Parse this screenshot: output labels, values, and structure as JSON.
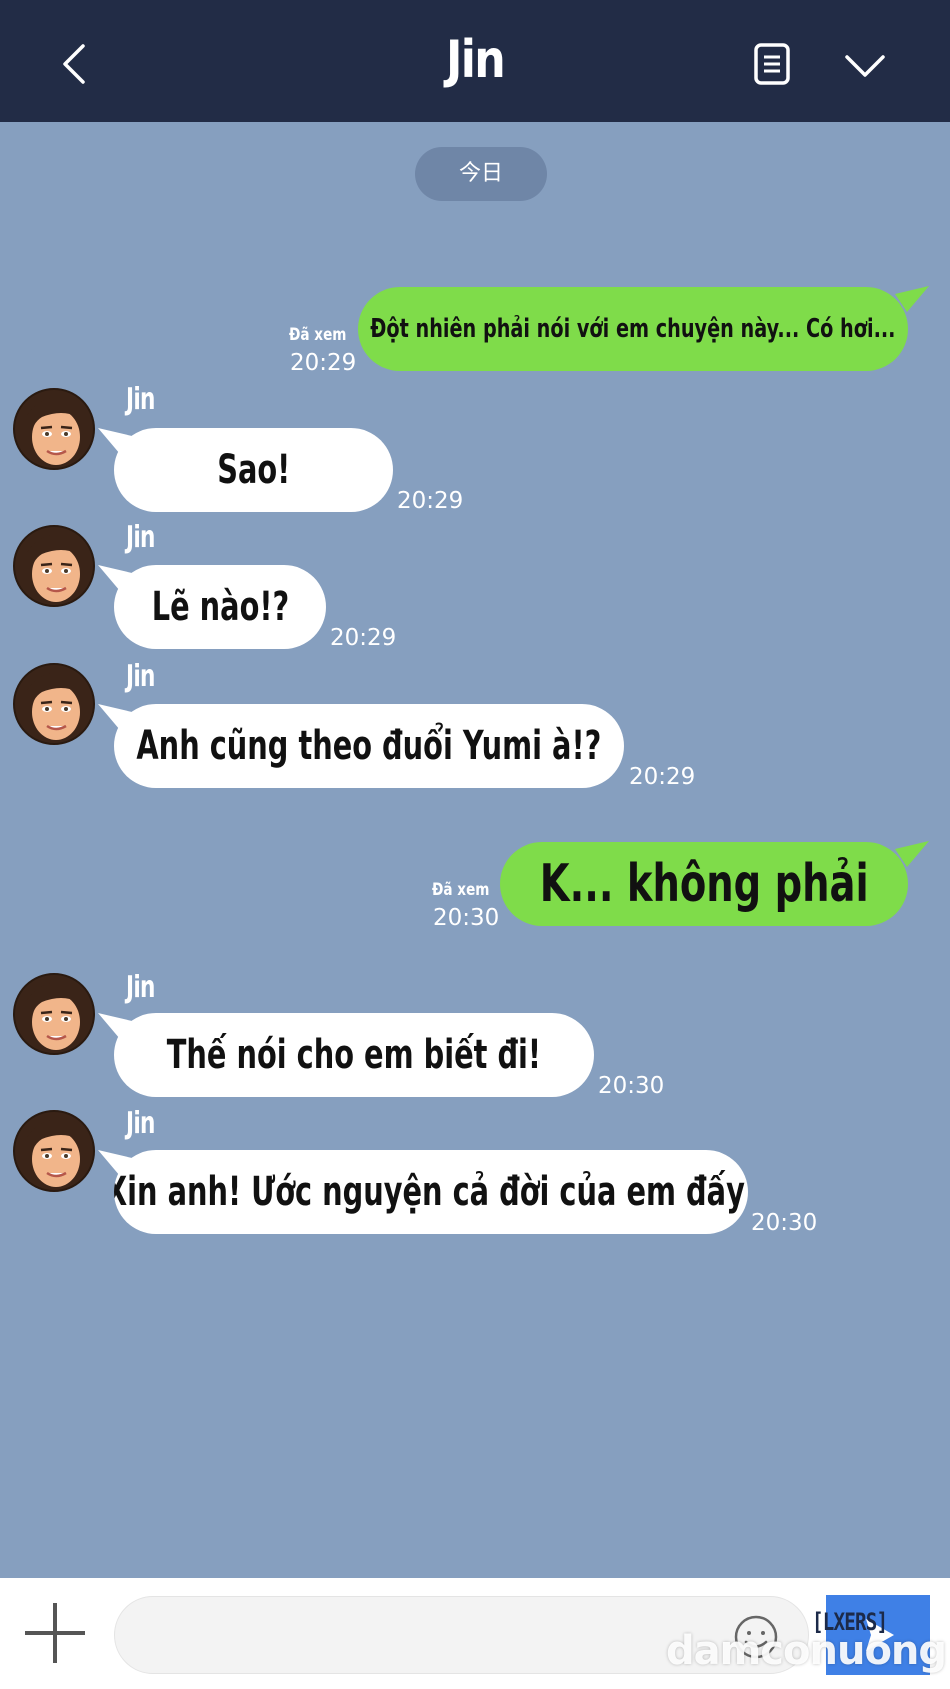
{
  "header": {
    "title": "Jin",
    "back_icon": "chevron-left-icon",
    "notes_icon": "notes-icon",
    "menu_icon": "chevron-down-icon",
    "background": "#222c46"
  },
  "date_divider": "今日",
  "colors": {
    "chat_background": "#869fbf",
    "outgoing_bubble": "#7fdc4a",
    "incoming_bubble": "#ffffff",
    "send_button": "#3f80e6"
  },
  "messages": [
    {
      "direction": "out",
      "text": "Đột nhiên phải nói với em chuyện này... Có hơi...",
      "read": "Đã xem",
      "time": "20:29"
    },
    {
      "direction": "in",
      "sender": "Jin",
      "text": "Sao!",
      "time": "20:29"
    },
    {
      "direction": "in",
      "sender": "Jin",
      "text": "Lẽ nào!?",
      "time": "20:29"
    },
    {
      "direction": "in",
      "sender": "Jin",
      "text": "Anh cũng theo đuổi Yumi à!?",
      "time": "20:29"
    },
    {
      "direction": "out",
      "text": "K... không phải",
      "read": "Đã xem",
      "time": "20:30"
    },
    {
      "direction": "in",
      "sender": "Jin",
      "text": "Thế nói cho em biết đi!",
      "time": "20:30"
    },
    {
      "direction": "in",
      "sender": "Jin",
      "text": "Xin anh! Ước nguyện cả đời của em đấy!",
      "time": "20:30"
    }
  ],
  "input_bar": {
    "placeholder": "",
    "add_icon": "plus-icon",
    "emoji_icon": "emoji-icon",
    "send_icon": "send-icon"
  },
  "watermark": {
    "group": "[LXERS]",
    "site": "damconuong"
  }
}
